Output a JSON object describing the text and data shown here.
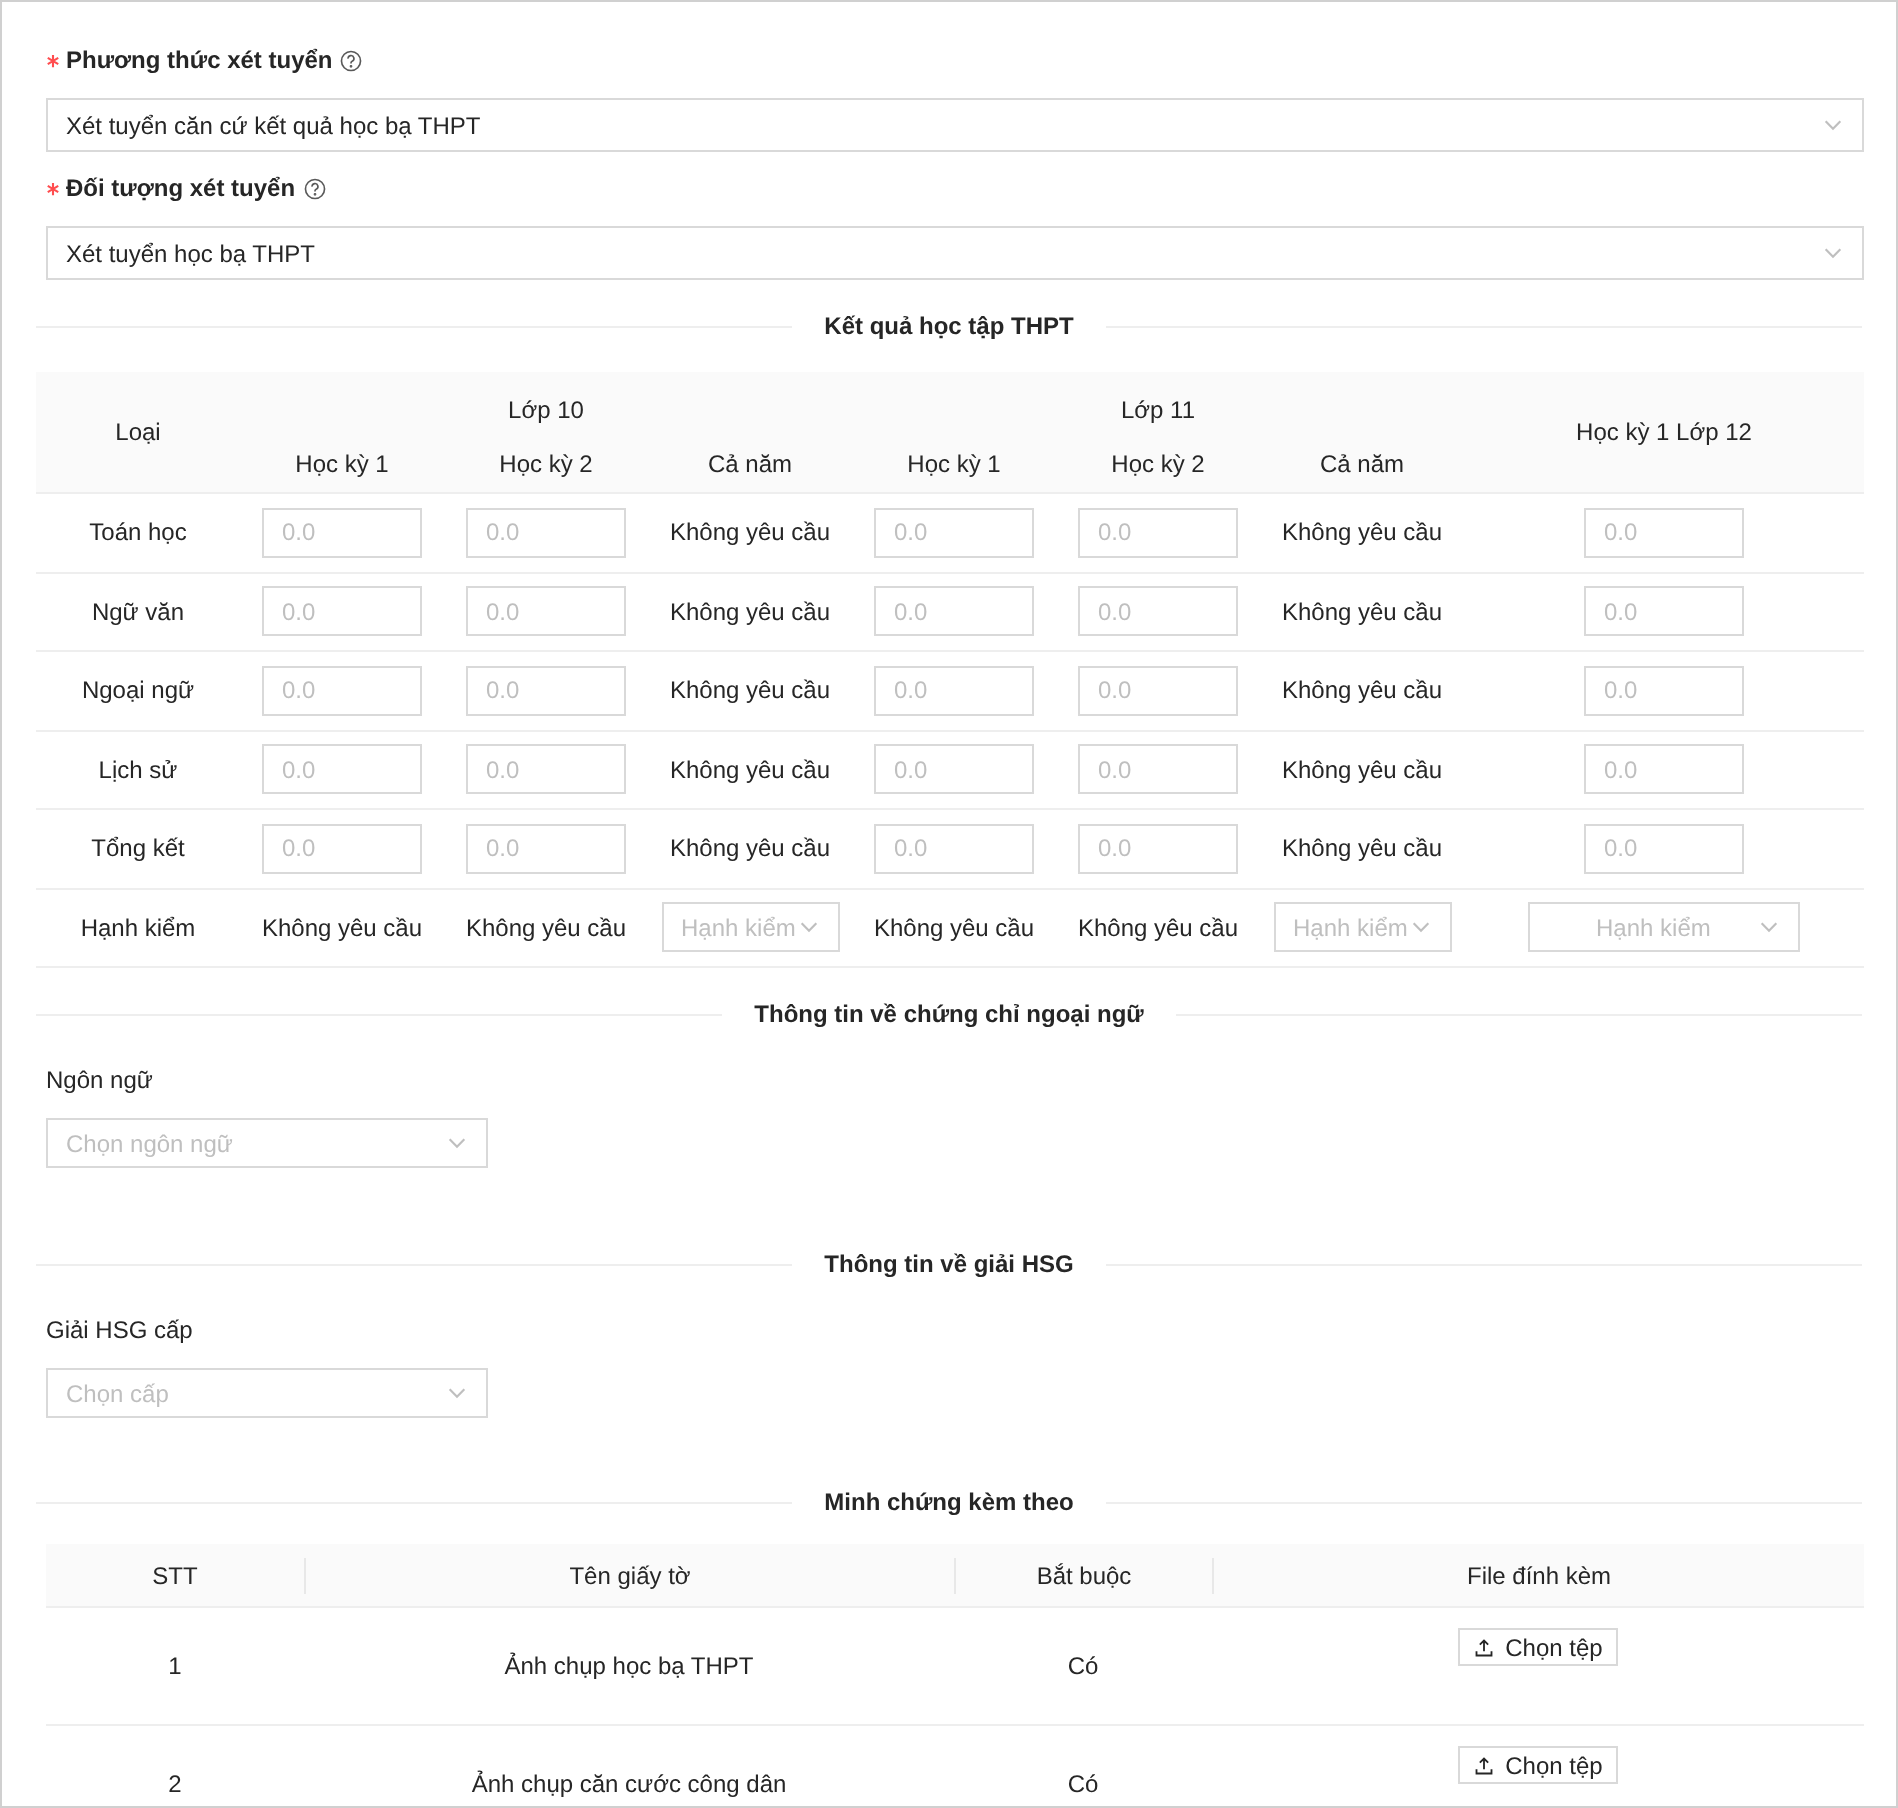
{
  "fields": [
    {
      "label": "Phương thức xét tuyển",
      "required": true,
      "help": true,
      "value": "Xét tuyển căn cứ kết quả học bạ THPT"
    },
    {
      "label": "Đối tượng xét tuyển",
      "required": true,
      "help": true,
      "value": "Xét tuyển học bạ THPT"
    }
  ],
  "scores": {
    "title": "Kết quả học tập THPT",
    "type_header": "Loại",
    "groups": [
      {
        "label": "Lớp 10",
        "columns": [
          "Học kỳ 1",
          "Học kỳ 2",
          "Cả năm"
        ]
      },
      {
        "label": "Lớp 11",
        "columns": [
          "Học kỳ 1",
          "Học kỳ 2",
          "Cả năm"
        ]
      }
    ],
    "last_header": "Học kỳ 1 Lớp 12",
    "rows": [
      {
        "label": "Toán học",
        "cells": [
          {
            "kind": "input",
            "placeholder": "0.0"
          },
          {
            "kind": "input",
            "placeholder": "0.0"
          },
          {
            "kind": "text",
            "text": "Không yêu cầu"
          },
          {
            "kind": "input",
            "placeholder": "0.0"
          },
          {
            "kind": "input",
            "placeholder": "0.0"
          },
          {
            "kind": "text",
            "text": "Không yêu cầu"
          },
          {
            "kind": "input",
            "placeholder": "0.0"
          }
        ]
      },
      {
        "label": "Ngữ văn",
        "cells": [
          {
            "kind": "input",
            "placeholder": "0.0"
          },
          {
            "kind": "input",
            "placeholder": "0.0"
          },
          {
            "kind": "text",
            "text": "Không yêu cầu"
          },
          {
            "kind": "input",
            "placeholder": "0.0"
          },
          {
            "kind": "input",
            "placeholder": "0.0"
          },
          {
            "kind": "text",
            "text": "Không yêu cầu"
          },
          {
            "kind": "input",
            "placeholder": "0.0"
          }
        ]
      },
      {
        "label": "Ngoại ngữ",
        "cells": [
          {
            "kind": "input",
            "placeholder": "0.0"
          },
          {
            "kind": "input",
            "placeholder": "0.0"
          },
          {
            "kind": "text",
            "text": "Không yêu cầu"
          },
          {
            "kind": "input",
            "placeholder": "0.0"
          },
          {
            "kind": "input",
            "placeholder": "0.0"
          },
          {
            "kind": "text",
            "text": "Không yêu cầu"
          },
          {
            "kind": "input",
            "placeholder": "0.0"
          }
        ]
      },
      {
        "label": "Lịch sử",
        "cells": [
          {
            "kind": "input",
            "placeholder": "0.0"
          },
          {
            "kind": "input",
            "placeholder": "0.0"
          },
          {
            "kind": "text",
            "text": "Không yêu cầu"
          },
          {
            "kind": "input",
            "placeholder": "0.0"
          },
          {
            "kind": "input",
            "placeholder": "0.0"
          },
          {
            "kind": "text",
            "text": "Không yêu cầu"
          },
          {
            "kind": "input",
            "placeholder": "0.0"
          }
        ]
      },
      {
        "label": "Tổng kết",
        "cells": [
          {
            "kind": "input",
            "placeholder": "0.0"
          },
          {
            "kind": "input",
            "placeholder": "0.0"
          },
          {
            "kind": "text",
            "text": "Không yêu cầu"
          },
          {
            "kind": "input",
            "placeholder": "0.0"
          },
          {
            "kind": "input",
            "placeholder": "0.0"
          },
          {
            "kind": "text",
            "text": "Không yêu cầu"
          },
          {
            "kind": "input",
            "placeholder": "0.0"
          }
        ]
      },
      {
        "label": "Hạnh kiểm",
        "cells": [
          {
            "kind": "text",
            "text": "Không yêu cầu"
          },
          {
            "kind": "text",
            "text": "Không yêu cầu"
          },
          {
            "kind": "select",
            "placeholder": "Hạnh kiểm"
          },
          {
            "kind": "text",
            "text": "Không yêu cầu"
          },
          {
            "kind": "text",
            "text": "Không yêu cầu"
          },
          {
            "kind": "select",
            "placeholder": "Hạnh kiểm"
          },
          {
            "kind": "select",
            "placeholder": "Hạnh kiểm"
          }
        ]
      }
    ]
  },
  "sections": [
    {
      "title": "Thông tin về chứng chỉ ngoại ngữ",
      "label": "Ngôn ngữ",
      "placeholder": "Chọn ngôn ngữ"
    },
    {
      "title": "Thông tin về giải HSG",
      "label": "Giải HSG cấp",
      "placeholder": "Chọn cấp"
    }
  ],
  "documents": {
    "title": "Minh chứng kèm theo",
    "columns": [
      "STT",
      "Tên giấy tờ",
      "Bắt buộc",
      "File đính kèm"
    ],
    "rows": [
      {
        "index": "1",
        "name": "Ảnh chụp học bạ THPT",
        "required": "Có",
        "button": "Chọn tệp"
      },
      {
        "index": "2",
        "name": "Ảnh chụp căn cước công dân",
        "required": "Có",
        "button": "Chọn tệp"
      }
    ]
  }
}
